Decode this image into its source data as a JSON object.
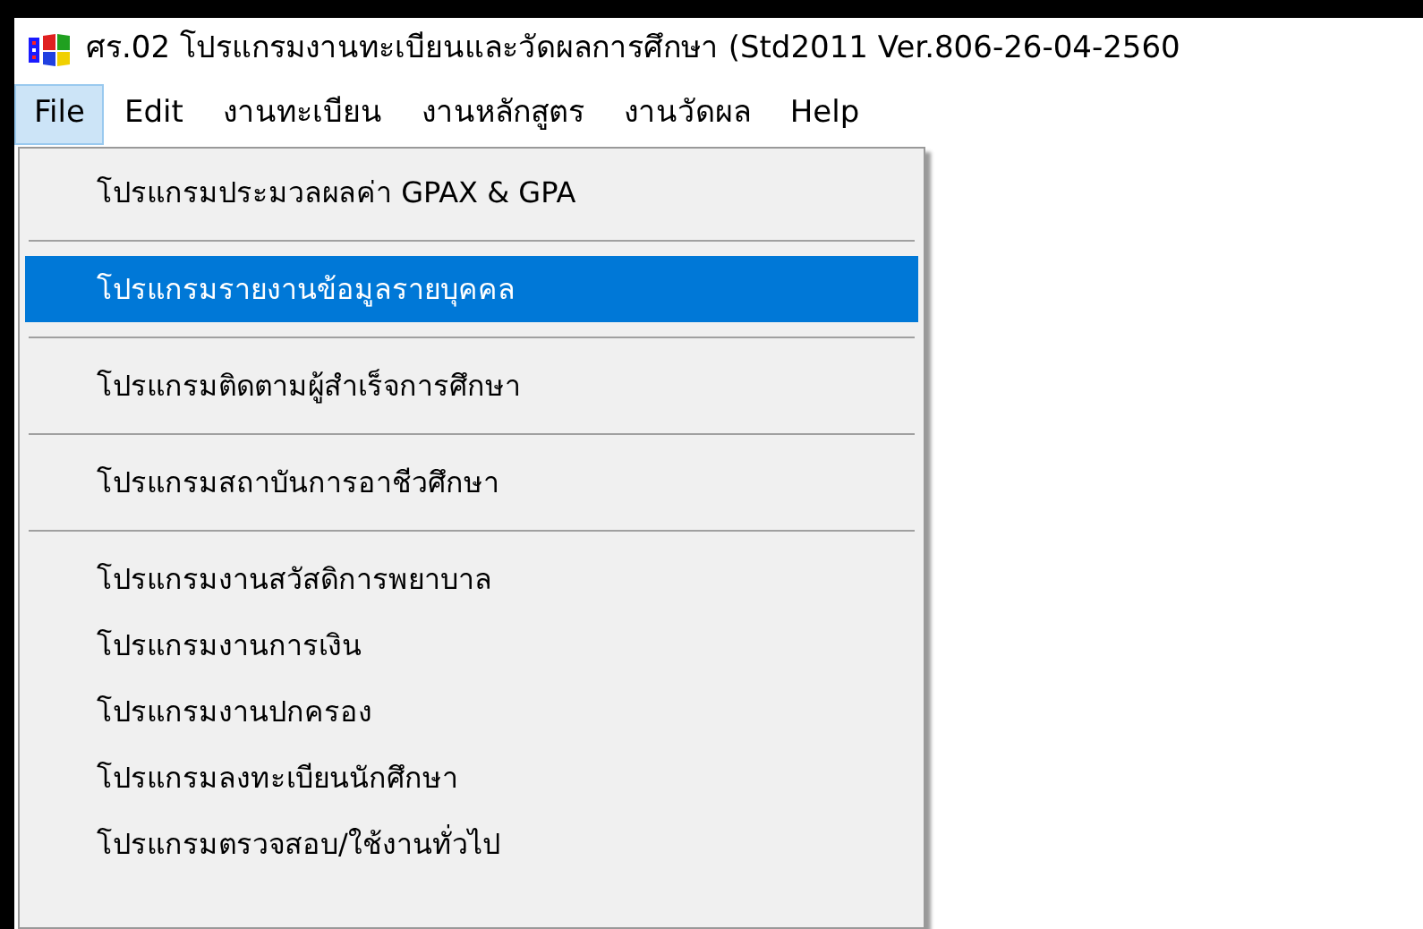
{
  "window": {
    "title": "ศร.02 โปรแกรมงานทะเบียนและวัดผลการศึกษา (Std2011 Ver.806-26-04-2560"
  },
  "menu_bar": [
    {
      "label": "File",
      "selected": true
    },
    {
      "label": "Edit",
      "selected": false
    },
    {
      "label": "งานทะเบียน",
      "selected": false
    },
    {
      "label": "งานหลักสูตร",
      "selected": false
    },
    {
      "label": "งานวัดผล",
      "selected": false
    },
    {
      "label": "Help",
      "selected": false
    }
  ],
  "dropdown": [
    {
      "kind": "item",
      "label": "โปรแกรมประมวลผลค่า GPAX & GPA",
      "selected": false
    },
    {
      "kind": "separator"
    },
    {
      "kind": "item",
      "label": "โปรแกรมรายงานข้อมูลรายบุคคล",
      "selected": true
    },
    {
      "kind": "separator"
    },
    {
      "kind": "item",
      "label": "โปรแกรมติดตามผู้สำเร็จการศึกษา",
      "selected": false
    },
    {
      "kind": "separator"
    },
    {
      "kind": "item",
      "label": "โปรแกรมสถาบันการอาชีวศึกษา",
      "selected": false
    },
    {
      "kind": "separator"
    },
    {
      "kind": "item",
      "label": "โปรแกรมงานสวัสดิการพยาบาล",
      "selected": false
    },
    {
      "kind": "item",
      "label": "โปรแกรมงานการเงิน",
      "selected": false
    },
    {
      "kind": "item",
      "label": "โปรแกรมงานปกครอง",
      "selected": false
    },
    {
      "kind": "item",
      "label": "โปรแกรมลงทะเบียนนักศึกษา",
      "selected": false
    },
    {
      "kind": "item",
      "label": "โปรแกรมตรวจสอบ/ใช้งานทั่วไป",
      "selected": false
    }
  ]
}
